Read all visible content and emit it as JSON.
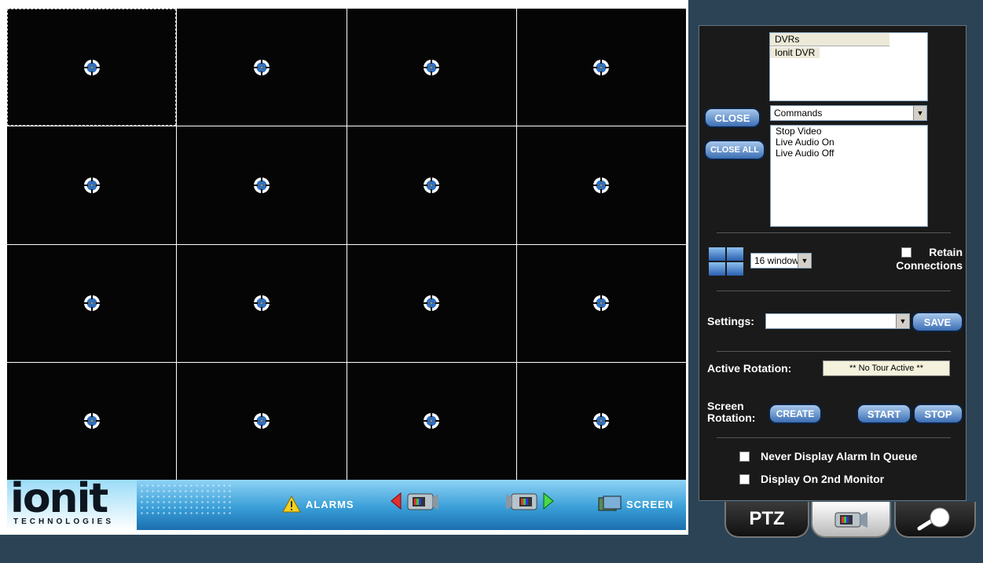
{
  "dvr_list": {
    "header": "DVRs",
    "items": [
      "Ionit DVR"
    ]
  },
  "commands": {
    "selected": "Commands",
    "items": [
      "Stop Video",
      "Live Audio On",
      "Live Audio Off"
    ]
  },
  "buttons": {
    "close": "CLOSE",
    "close_all": "CLOSE ALL",
    "save": "SAVE",
    "create": "CREATE",
    "start": "START",
    "stop": "STOP"
  },
  "layout": {
    "selected": "16 window",
    "retain_line1": "Retain",
    "retain_line2": "Connections"
  },
  "settings": {
    "label": "Settings:",
    "value": ""
  },
  "rotation": {
    "active_label": "Active Rotation:",
    "active_value": "** No Tour Active **",
    "screen_label_1": "Screen",
    "screen_label_2": "Rotation:"
  },
  "options": {
    "never_alarm": "Never Display Alarm In Queue",
    "second_monitor": "Display On 2nd Monitor"
  },
  "bottom_bar": {
    "logo": "ionit",
    "logo_sub": "TECHNOLOGIES",
    "alarms": "ALARMS",
    "screen": "SCREEN"
  },
  "tabs": {
    "ptz": "PTZ"
  },
  "grid": {
    "cells": 16
  }
}
